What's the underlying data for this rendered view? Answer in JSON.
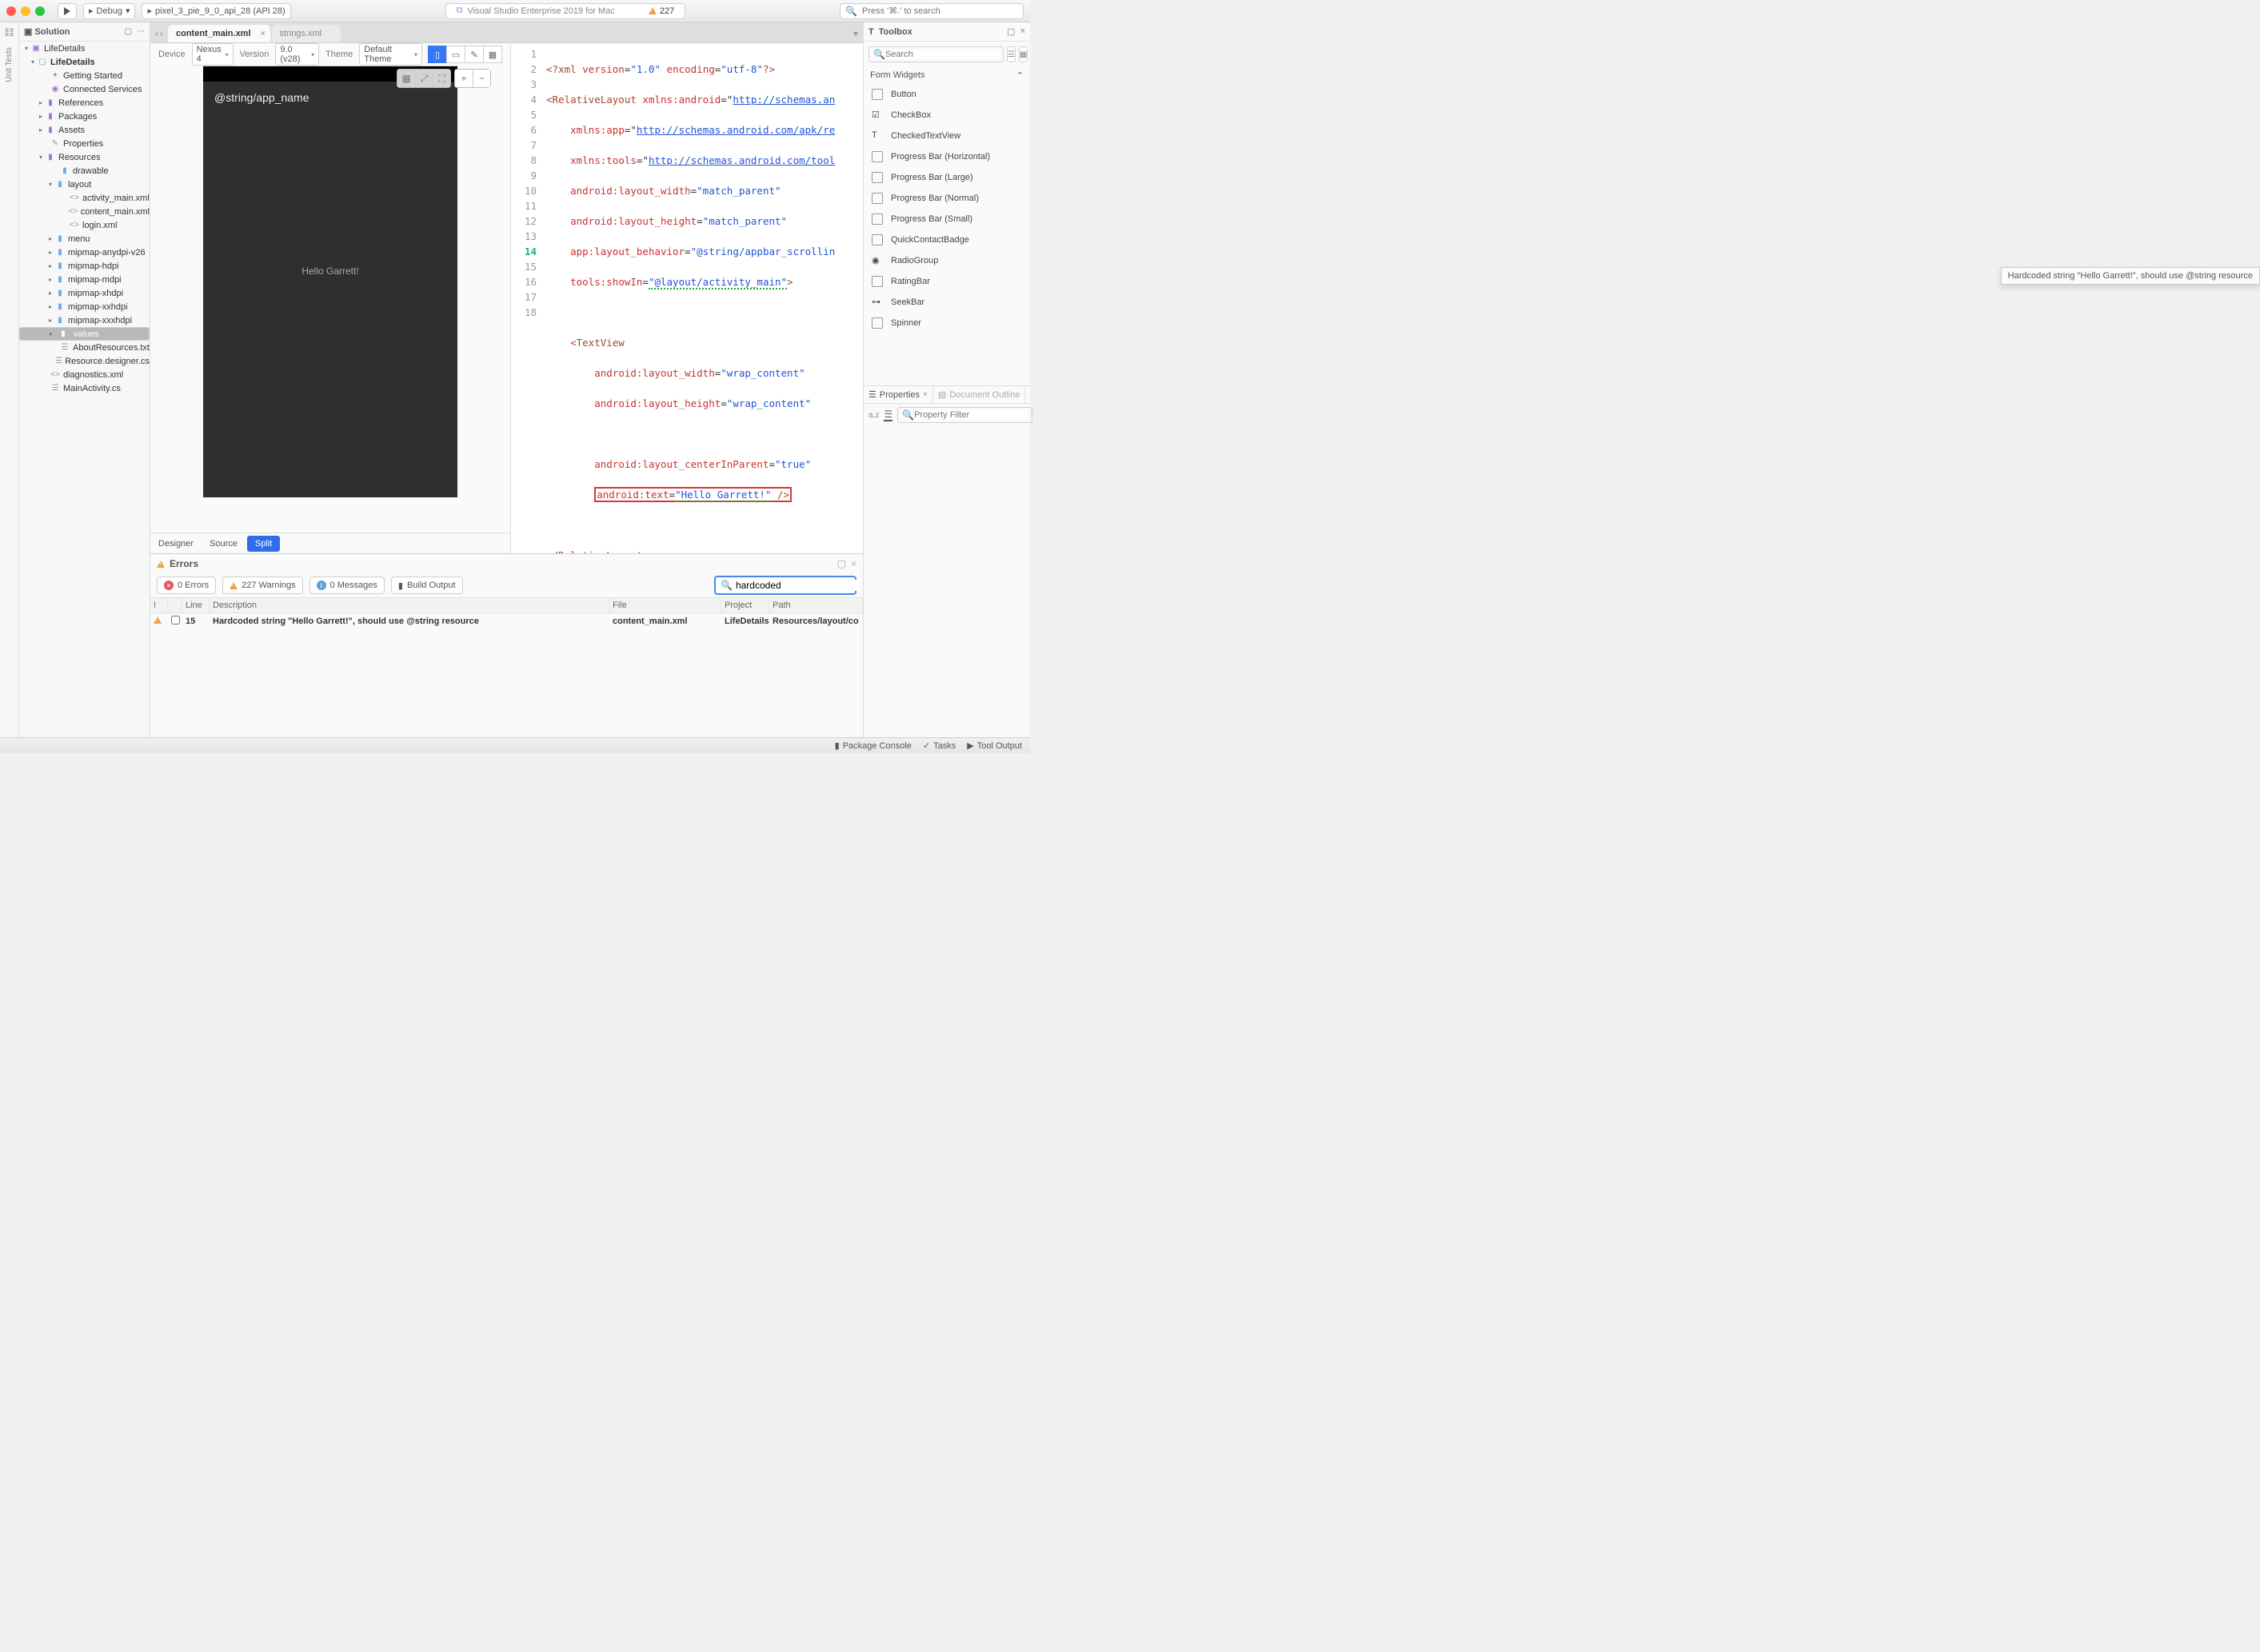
{
  "titlebar": {
    "config_debug": "Debug",
    "device": "pixel_3_pie_9_0_api_28 (API 28)",
    "center_title": "Visual Studio Enterprise 2019 for Mac",
    "warn_count": "227",
    "search_placeholder": "Press '⌘.' to search"
  },
  "left_strip": {
    "unit_tests": "Unit Tests"
  },
  "solution": {
    "title": "Solution",
    "nodes": {
      "root": "LifeDetails",
      "proj": "LifeDetails",
      "getting_started": "Getting Started",
      "connected": "Connected Services",
      "references": "References",
      "packages": "Packages",
      "assets": "Assets",
      "properties": "Properties",
      "resources": "Resources",
      "drawable": "drawable",
      "layout": "layout",
      "layout_files": [
        "activity_main.xml",
        "content_main.xml",
        "login.xml"
      ],
      "menu": "menu",
      "mip": [
        "mipmap-anydpi-v26",
        "mipmap-hdpi",
        "mipmap-mdpi",
        "mipmap-xhdpi",
        "mipmap-xxhdpi",
        "mipmap-xxxhdpi"
      ],
      "values": "values",
      "about": "AboutResources.txt",
      "resdes": "Resource.designer.cs",
      "diag": "diagnostics.xml",
      "main": "MainActivity.cs"
    }
  },
  "tabs": {
    "active": "content_main.xml",
    "inactive": "strings.xml"
  },
  "designer_toolbar": {
    "device_lbl": "Device",
    "device_val": "Nexus 4",
    "version_lbl": "Version",
    "version_val": "9.0 (v28)",
    "theme_lbl": "Theme",
    "theme_val": "Default Theme"
  },
  "phone_preview": {
    "appbar": "@string/app_name",
    "body": "Hello Garrett!"
  },
  "designer_tabs": {
    "designer": "Designer",
    "source": "Source",
    "split": "Split"
  },
  "code": {
    "l1a": "<?xml ",
    "l1b": "version",
    "l1c": "=",
    "l1d": "\"1.0\"",
    "l1e": " encoding",
    "l1f": "=",
    "l1g": "\"utf-8\"",
    "l1h": "?>",
    "l2a": "<RelativeLayout ",
    "l2b": "xmlns:android",
    "l2c": "=\"",
    "l2d": "http://schemas.an",
    "l3a": "    ",
    "l3b": "xmlns:app",
    "l3c": "=\"",
    "l3d": "http://schemas.android.com/apk/re",
    "l4b": "xmlns:tools",
    "l4d": "http://schemas.android.com/tool",
    "l5b": "android:layout_width",
    "l5d": "\"match_parent\"",
    "l6b": "android:layout_height",
    "l6d": "\"match_parent\"",
    "l7b": "app:layout_behavior",
    "l7d": "\"@string/appbar_scrollin",
    "l8b": "tools:showIn",
    "l8d": "\"@layout/activity_main\"",
    "l8e": ">",
    "l10": "    <TextView",
    "l11b": "android:layout_width",
    "l11d": "\"wrap_content\"",
    "l12b": "android:layout_height",
    "l12d": "\"wrap_content\"",
    "l14b": "android:layout_centerInParent",
    "l14d": "\"true\"",
    "l15b": "android:text",
    "l15d": "\"Hello Garrett!\"",
    "l15e": " />",
    "l17": "</RelativeLayout>"
  },
  "tooltip": "Hardcoded string \"Hello Garrett!\", should use @string resource",
  "errors": {
    "title": "Errors",
    "filters": {
      "errors": "0 Errors",
      "warnings": "227 Warnings",
      "messages": "0 Messages",
      "build": "Build Output"
    },
    "search": "hardcoded",
    "cols": {
      "bang": "!",
      "line": "Line",
      "desc": "Description",
      "file": "File",
      "project": "Project",
      "path": "Path"
    },
    "rows": [
      {
        "line": "15",
        "desc": "Hardcoded string \"Hello Garrett!\", should use @string resource",
        "file": "content_main.xml",
        "project": "LifeDetails",
        "path": "Resources/layout/co"
      }
    ]
  },
  "toolbox": {
    "title": "Toolbox",
    "search_placeholder": "Search",
    "category": "Form Widgets",
    "items": [
      "Button",
      "CheckBox",
      "CheckedTextView",
      "Progress Bar (Horizontal)",
      "Progress Bar (Large)",
      "Progress Bar (Normal)",
      "Progress Bar (Small)",
      "QuickContactBadge",
      "RadioGroup",
      "RatingBar",
      "SeekBar",
      "Spinner"
    ],
    "prop_tab": "Properties",
    "doc_outline": "Document Outline",
    "az": "a.z",
    "prop_placeholder": "Property Filter"
  },
  "status": {
    "pkg": "Package Console",
    "tasks": "Tasks",
    "tool": "Tool Output"
  }
}
